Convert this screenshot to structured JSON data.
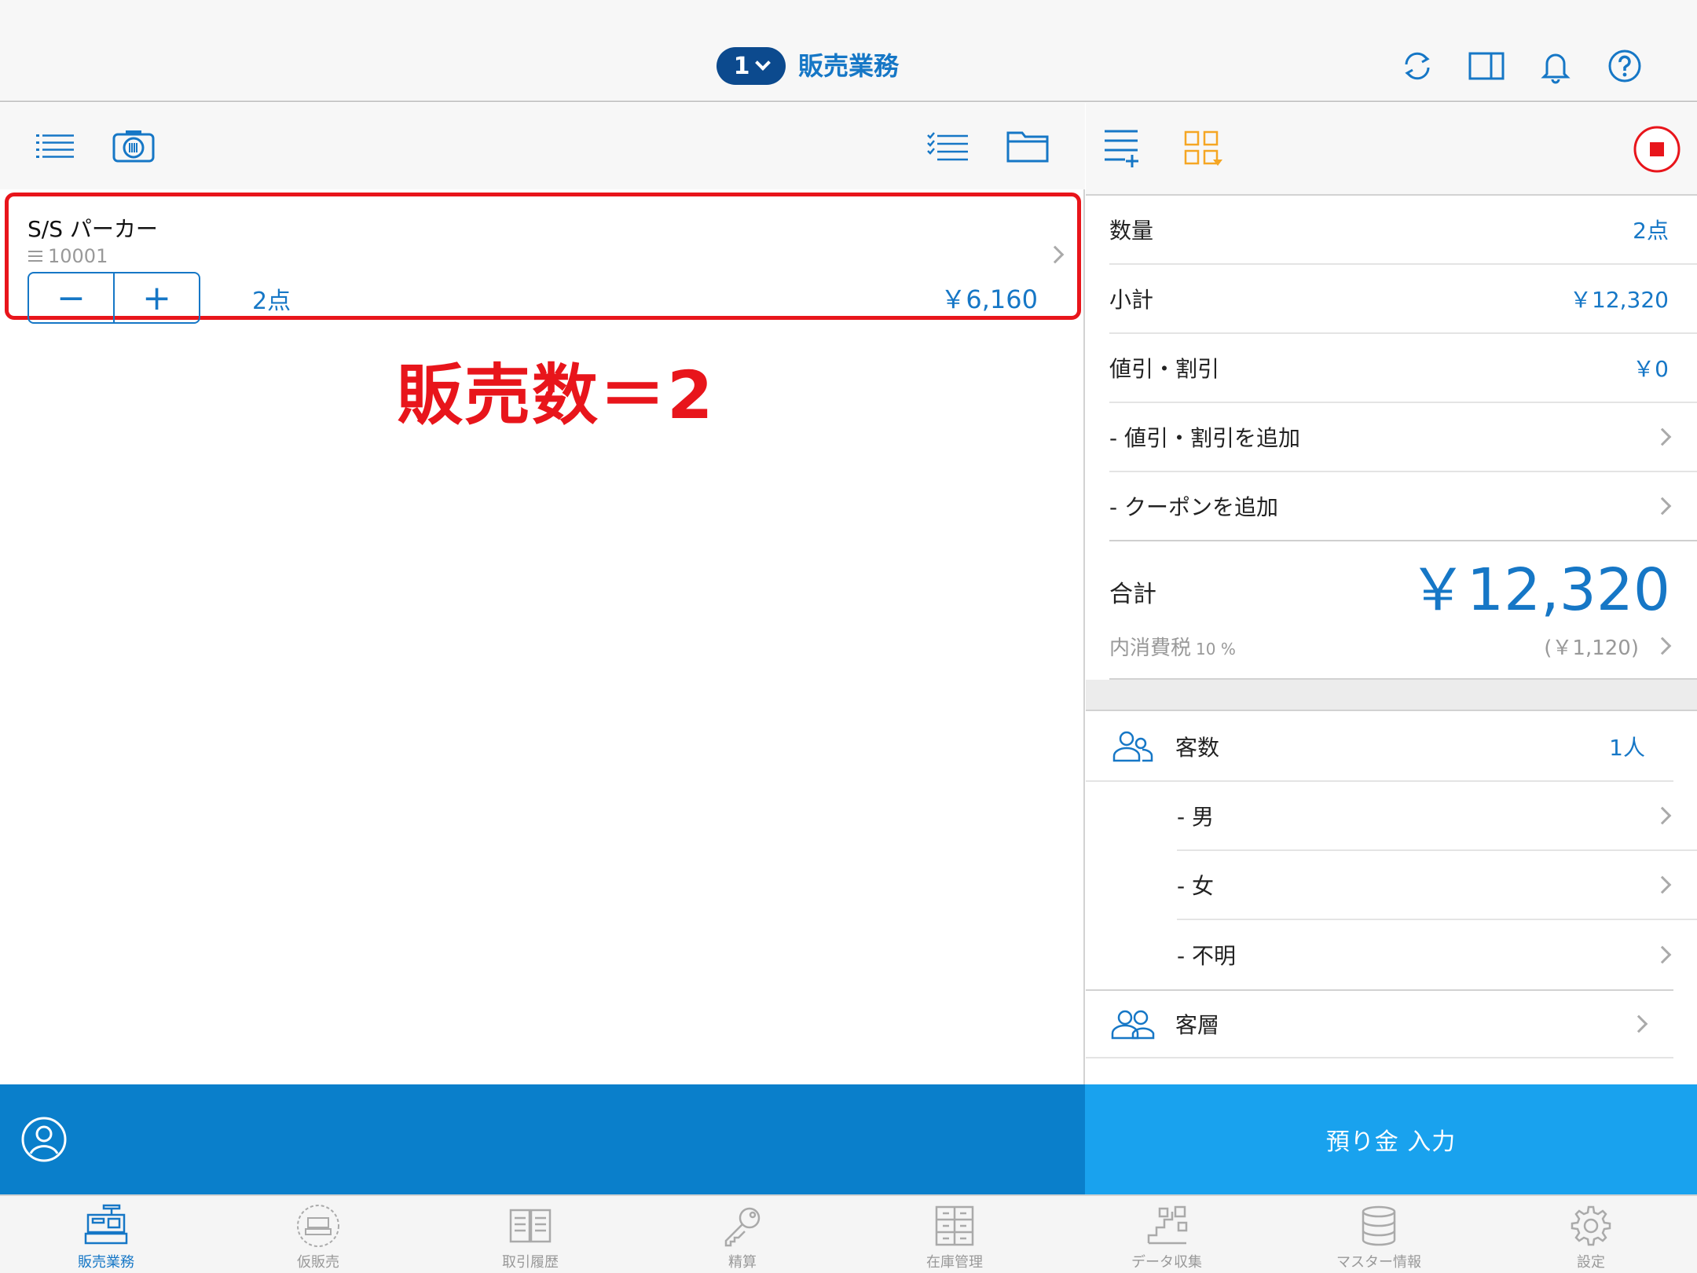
{
  "header": {
    "register_number": "1",
    "title": "販売業務"
  },
  "item": {
    "name": "S/S パーカー",
    "code": "10001",
    "minus": "−",
    "plus": "+",
    "quantity": "2点",
    "price": "￥6,160"
  },
  "annotation": "販売数＝2",
  "summary": {
    "qty_label": "数量",
    "qty_value": "2点",
    "subtotal_label": "小計",
    "subtotal_value": "￥12,320",
    "discount_label": "値引・割引",
    "discount_value": "￥0",
    "add_discount_label": "- 値引・割引を追加",
    "add_coupon_label": "- クーポンを追加",
    "total_label": "合計",
    "total_value": "￥12,320",
    "tax_label": "内消費税",
    "tax_pct": "10 %",
    "tax_value": "(￥1,120)"
  },
  "customers": {
    "count_label": "客数",
    "count_value": "1人",
    "male_label": "- 男",
    "female_label": "- 女",
    "unknown_label": "- 不明",
    "segment_label": "客層"
  },
  "deposit_button": "預り金 入力",
  "tabs": [
    {
      "label": "販売業務"
    },
    {
      "label": "仮販売"
    },
    {
      "label": "取引履歴"
    },
    {
      "label": "精算"
    },
    {
      "label": "在庫管理"
    },
    {
      "label": "データ収集"
    },
    {
      "label": "マスター情報"
    },
    {
      "label": "設定"
    }
  ],
  "colors": {
    "accent": "#1677c6",
    "annotation_red": "#e8151b",
    "customer_bar": "#0a7fcb",
    "deposit_button": "#19a2ee",
    "register_pill": "#0c4a8e"
  }
}
